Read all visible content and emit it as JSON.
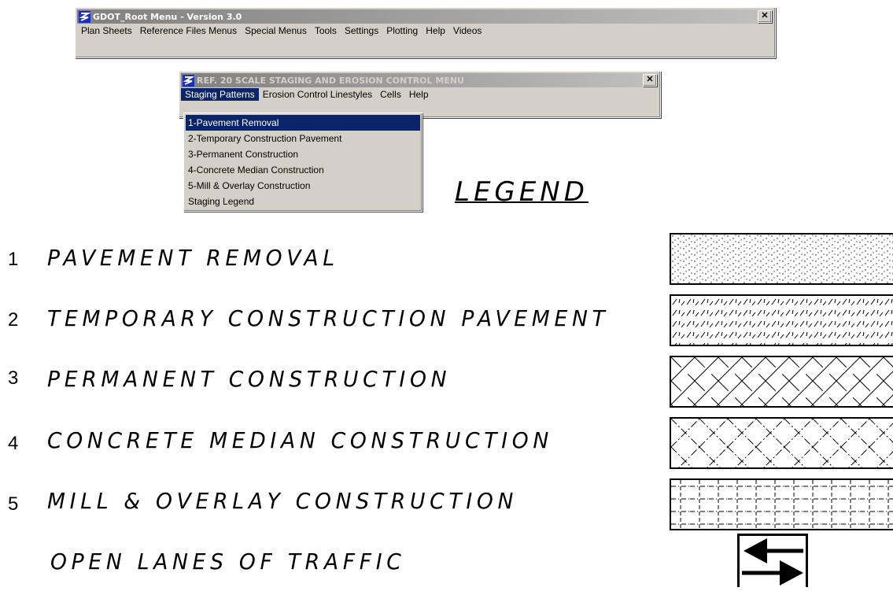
{
  "root_window": {
    "title": "GDOT_Root Menu - Version 3.0",
    "close_label": "✕",
    "menu": [
      "Plan Sheets",
      "Reference Files Menus",
      "Special Menus",
      "Tools",
      "Settings",
      "Plotting",
      "Help",
      "Videos"
    ]
  },
  "staging_window": {
    "title": "REF. 20 SCALE STAGING AND EROSION CONTROL MENU",
    "close_label": "✕",
    "menu": [
      "Staging Patterns",
      "Erosion Control Linestyles",
      "Cells",
      "Help"
    ],
    "open_menu": "Staging Patterns"
  },
  "dropdown": {
    "items": [
      "1-Pavement Removal",
      "2-Temporary Construction Pavement",
      "3-Permanent Construction",
      "4-Concrete Median Construction",
      "5-Mill & Overlay Construction",
      "Staging Legend"
    ],
    "selected": "1-Pavement Removal"
  },
  "drawing": {
    "legend_title": "LEGEND",
    "rows": [
      {
        "number": "1",
        "label": "PAVEMENT REMOVAL",
        "pattern": "dots"
      },
      {
        "number": "2",
        "label": "TEMPORARY CONSTRUCTION PAVEMENT",
        "pattern": "short-slashes"
      },
      {
        "number": "3",
        "label": "PERMANENT CONSTRUCTION",
        "pattern": "crosshatch"
      },
      {
        "number": "4",
        "label": "CONCRETE MEDIAN CONSTRUCTION",
        "pattern": "dashed-crosshatch"
      },
      {
        "number": "5",
        "label": "MILL & OVERLAY CONSTRUCTION",
        "pattern": "dashed-grid"
      }
    ],
    "traffic_label": "OPEN LANES OF TRAFFIC",
    "traffic_symbol": "opposing-arrows-icon"
  },
  "colors": {
    "menu_face": "#d4d0c8",
    "selection": "#0a246a",
    "drawing_ink": "#000000"
  }
}
